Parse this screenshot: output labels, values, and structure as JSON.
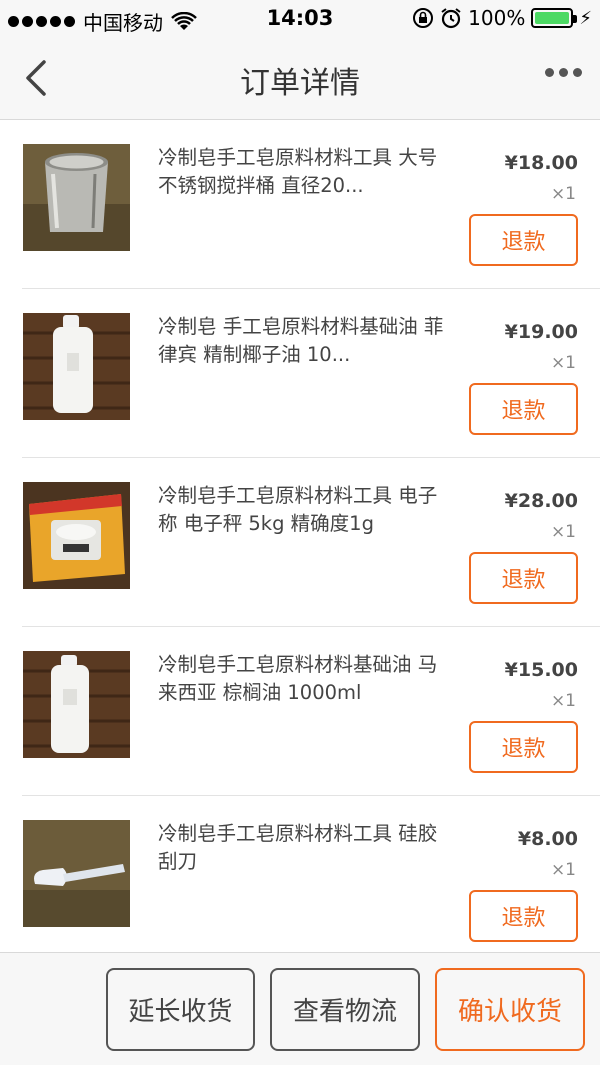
{
  "status_bar": {
    "carrier": "中国移动",
    "time": "14:03",
    "battery": "100%",
    "battery_level": 1.0
  },
  "nav": {
    "title": "订单详情"
  },
  "items": [
    {
      "title": "冷制皂手工皂原料材料工具 大号不锈钢搅拌桶 直径20...",
      "price": "¥18.00",
      "qty": "×1",
      "refund": "退款"
    },
    {
      "title": "冷制皂 手工皂原料材料基础油 菲律宾 精制椰子油 10...",
      "price": "¥19.00",
      "qty": "×1",
      "refund": "退款"
    },
    {
      "title": "冷制皂手工皂原料材料工具 电子称 电子秤 5kg 精确度1g",
      "price": "¥28.00",
      "qty": "×1",
      "refund": "退款"
    },
    {
      "title": "冷制皂手工皂原料材料基础油 马来西亚 棕榈油 1000ml",
      "price": "¥15.00",
      "qty": "×1",
      "refund": "退款"
    },
    {
      "title": "冷制皂手工皂原料材料工具 硅胶刮刀",
      "price": "¥8.00",
      "qty": "×1",
      "refund": "退款"
    }
  ],
  "bottom": {
    "extend": "延长收货",
    "track": "查看物流",
    "confirm": "确认收货"
  },
  "colors": {
    "accent": "#f06a1f",
    "battery": "#4cd964"
  }
}
